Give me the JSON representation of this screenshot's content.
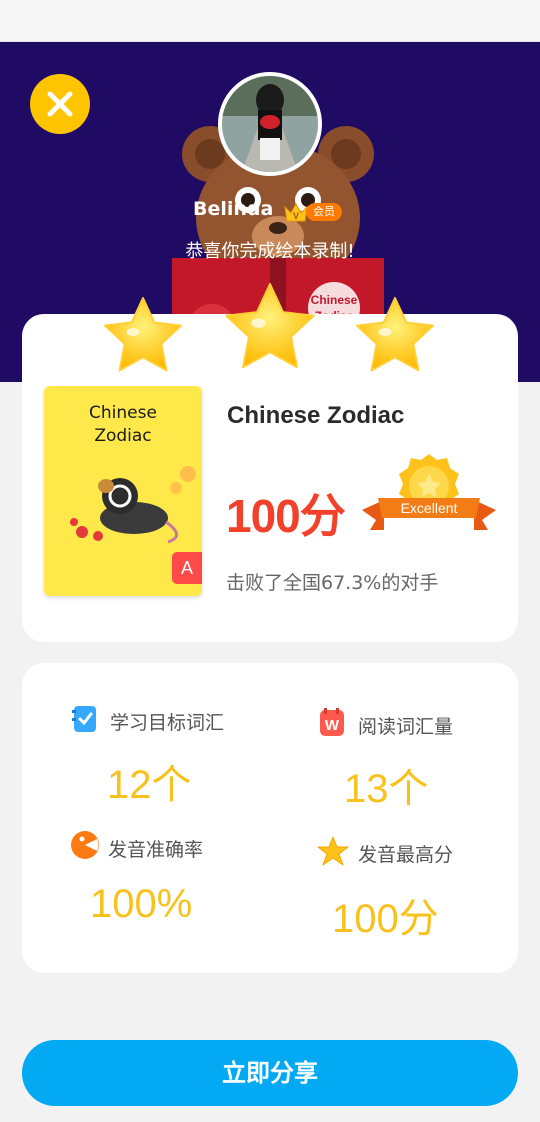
{
  "header": {
    "username": "Belinda",
    "vip_label": "会员",
    "congrats_text": "恭喜你完成绘本录制!",
    "bear_sign_text": [
      "Chinese",
      "Zodiac"
    ]
  },
  "result": {
    "stars_earned": 3,
    "stars_total": 3,
    "book_cover_title": [
      "Chinese",
      "Zodiac"
    ],
    "book_level": "A",
    "story_title": "Chinese Zodiac",
    "score": "100分",
    "badge_text": "Excellent",
    "beat_text": "击败了全国67.3%的对手"
  },
  "stats": [
    {
      "label": "学习目标词汇",
      "value": "12个",
      "icon": "vocabulary-check-icon",
      "color": "#34a9ff"
    },
    {
      "label": "阅读词汇量",
      "value": "13个",
      "icon": "reading-w-icon",
      "color": "#ff5a4e"
    },
    {
      "label": "发音准确率",
      "value": "100%",
      "icon": "pronunciation-icon",
      "color": "#ff7a12"
    },
    {
      "label": "发音最高分",
      "value": "100分",
      "icon": "star-icon",
      "color": "#ffc21b"
    }
  ],
  "share_button": "立即分享",
  "colors": {
    "hero_bg": "#1f0b63",
    "accent_yellow": "#ffc400",
    "score_red": "#f2412a",
    "share_blue": "#04a9f3"
  }
}
